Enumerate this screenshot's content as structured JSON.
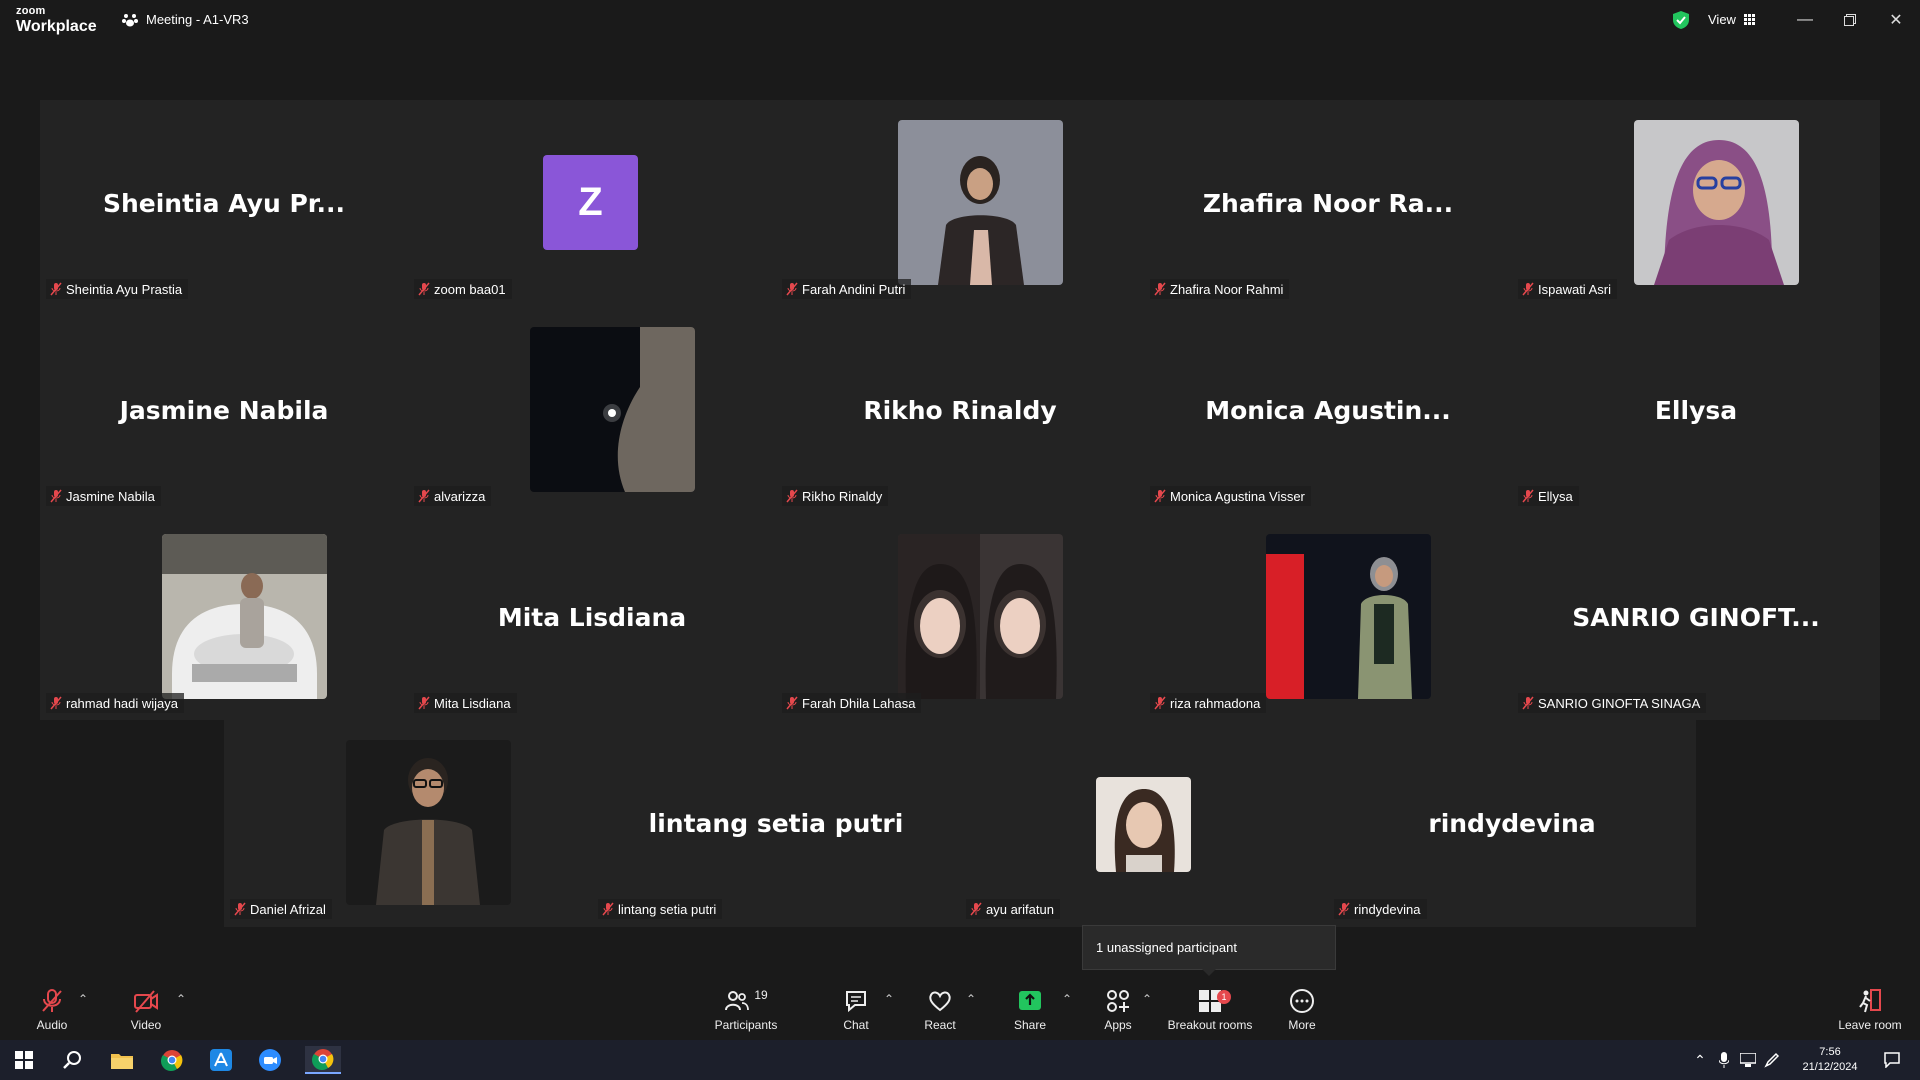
{
  "app": {
    "logo_line1": "zoom",
    "logo_line2": "Workplace",
    "meeting_title": "Meeting - A1-VR3",
    "view_label": "View"
  },
  "participants": [
    {
      "display": "Sheintia Ayu Pr...",
      "label": "Sheintia Ayu Prastia",
      "kind": "name"
    },
    {
      "display": "Z",
      "label": "zoom baa01",
      "kind": "avatar"
    },
    {
      "display": "",
      "label": "Farah Andini Putri",
      "kind": "photo"
    },
    {
      "display": "Zhafira Noor Ra...",
      "label": "Zhafira Noor Rahmi",
      "kind": "name"
    },
    {
      "display": "",
      "label": "Ispawati Asri",
      "kind": "photo"
    },
    {
      "display": "Jasmine Nabila",
      "label": "Jasmine Nabila",
      "kind": "name"
    },
    {
      "display": "",
      "label": "alvarizza",
      "kind": "photo"
    },
    {
      "display": "Rikho Rinaldy",
      "label": "Rikho Rinaldy",
      "kind": "name"
    },
    {
      "display": "Monica Agustin...",
      "label": "Monica Agustina Visser",
      "kind": "name"
    },
    {
      "display": "Ellysa",
      "label": "Ellysa",
      "kind": "name"
    },
    {
      "display": "",
      "label": "rahmad hadi wijaya",
      "kind": "photo"
    },
    {
      "display": "Mita Lisdiana",
      "label": "Mita Lisdiana",
      "kind": "name"
    },
    {
      "display": "",
      "label": "Farah Dhila Lahasa",
      "kind": "photo"
    },
    {
      "display": "",
      "label": "riza rahmadona",
      "kind": "photo"
    },
    {
      "display": "SANRIO GINOFT...",
      "label": "SANRIO GINOFTA SINAGA",
      "kind": "name"
    },
    {
      "display": "",
      "label": "Daniel Afrizal",
      "kind": "photo"
    },
    {
      "display": "lintang setia putri",
      "label": "lintang setia putri",
      "kind": "name"
    },
    {
      "display": "",
      "label": "ayu arifatun",
      "kind": "photo"
    },
    {
      "display": "rindydevina",
      "label": "rindydevina",
      "kind": "name"
    }
  ],
  "tooltip": "1 unassigned participant",
  "toolbar": {
    "audio": "Audio",
    "video": "Video",
    "participants": "Participants",
    "participants_count": "19",
    "chat": "Chat",
    "react": "React",
    "share": "Share",
    "apps": "Apps",
    "breakout": "Breakout rooms",
    "breakout_badge": "1",
    "more": "More",
    "leave": "Leave room"
  },
  "taskbar": {
    "time": "7:56",
    "date": "21/12/2024"
  },
  "colors": {
    "accent_green": "#22c55e",
    "avatar_purple": "#8a56d8",
    "mute_red": "#e5484d"
  }
}
